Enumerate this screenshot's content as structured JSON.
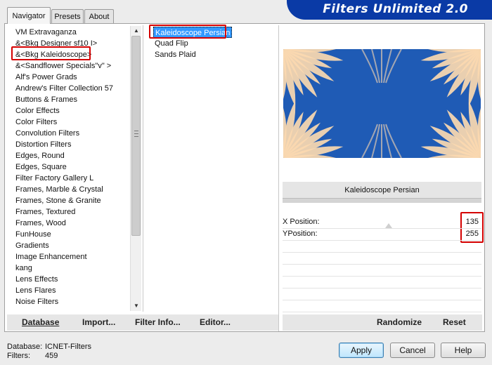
{
  "app": {
    "banner_title": "Filters Unlimited 2.0"
  },
  "tabs": [
    {
      "label": "Navigator",
      "active": true
    },
    {
      "label": "Presets",
      "active": false
    },
    {
      "label": "About",
      "active": false
    }
  ],
  "categories": [
    "VM Extravaganza",
    "&<Bkg Designer sf10 I>",
    "&<Bkg Kaleidoscope>",
    "&<Sandflower Specials\"v\" >",
    "Alf's Power Grads",
    "Andrew's Filter Collection 57",
    "Buttons & Frames",
    "Color Effects",
    "Color Filters",
    "Convolution Filters",
    "Distortion Filters",
    "Edges, Round",
    "Edges, Square",
    "Filter Factory Gallery L",
    "Frames, Marble & Crystal",
    "Frames, Stone & Granite",
    "Frames, Textured",
    "Frames, Wood",
    "FunHouse",
    "Gradients",
    "Image Enhancement",
    "kang",
    "Lens Effects",
    "Lens Flares",
    "Noise Filters"
  ],
  "selected_category": "&<Bkg Kaleidoscope>",
  "filters": [
    {
      "label": "Kaleidoscope Persian",
      "selected": true
    },
    {
      "label": "Quad Flip",
      "selected": false
    },
    {
      "label": "Sands Plaid",
      "selected": false
    }
  ],
  "preview": {
    "colors": {
      "primary": "#1f5bb5",
      "secondary": "#fbd9b0"
    }
  },
  "selected_filter_name": "Kaleidoscope Persian",
  "params": [
    {
      "label": "X Position:",
      "value": "135"
    },
    {
      "label": "YPosition:",
      "value": "255"
    }
  ],
  "toolbar": {
    "database": "Database",
    "import": "Import...",
    "filter_info": "Filter Info...",
    "editor": "Editor...",
    "randomize": "Randomize",
    "reset": "Reset"
  },
  "status": {
    "database_label": "Database:",
    "database_value": "ICNET-Filters",
    "filters_label": "Filters:",
    "filters_value": "459"
  },
  "buttons": {
    "apply": "Apply",
    "cancel": "Cancel",
    "help": "Help"
  },
  "accent_colors": {
    "selection": "#3399ff",
    "banner": "#0a3aa6",
    "highlight_box": "#d40000"
  }
}
